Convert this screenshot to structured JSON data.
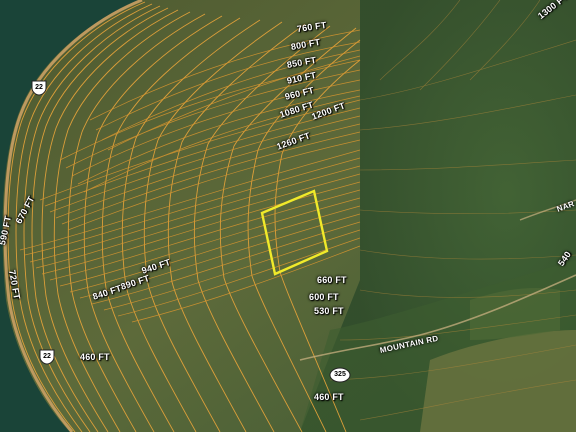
{
  "colors": {
    "water": "#1c4a3c",
    "terrain_light": "#5c6a3a",
    "terrain_dark": "#304a2a",
    "forest": "#3a5a2e",
    "contour": "#e3a23a",
    "parcel": "#f0ea2a",
    "road": "#c9a064"
  },
  "contour_labels": {
    "l760": "760 FT",
    "l800": "800 FT",
    "l850": "850 FT",
    "l910": "910 FT",
    "l960": "960 FT",
    "l1080": "1080 FT",
    "l1200": "1200 FT",
    "l1260": "1260 FT",
    "l1300": "1300 FT",
    "l940": "940 FT",
    "l890": "890 FT",
    "l840": "840 FT",
    "l660": "660 FT",
    "l600": "600 FT",
    "l530": "530 FT",
    "l540": "540",
    "l460a": "460 FT",
    "l460b": "460 FT",
    "l590": "590 FT",
    "l670": "670 FT",
    "l720": "720 FT"
  },
  "routes": {
    "r22_top": "22",
    "r22_bottom": "22",
    "r325": "325"
  },
  "roads": {
    "mountain_rd": "MOUNTAIN RD",
    "nar": "NAR"
  },
  "icons": {
    "route_shield": "us-route-shield-icon",
    "state_shield": "state-route-oval-icon",
    "parcel": "parcel-boundary"
  }
}
